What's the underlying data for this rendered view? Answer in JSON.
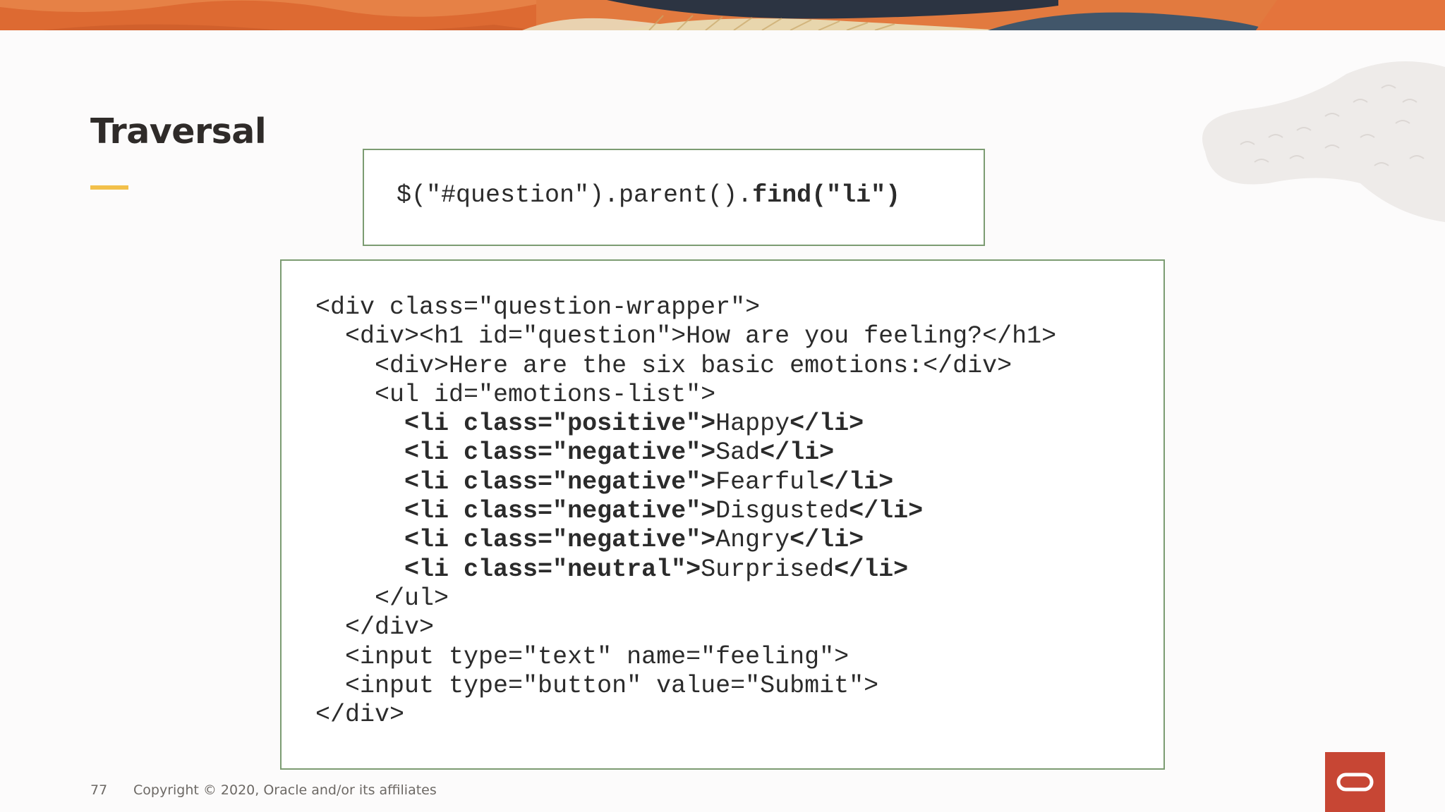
{
  "slide": {
    "title": "Traversal",
    "query": {
      "regular": "$(\"#question\").parent().",
      "bold": "find(\"li\")"
    },
    "code_lines": [
      {
        "indent": "",
        "parts": [
          {
            "t": "<div class=\"question-wrapper\">",
            "b": false
          }
        ]
      },
      {
        "indent": "  ",
        "parts": [
          {
            "t": "<div><h1 id=\"question\">How are you feeling?</h1>",
            "b": false
          }
        ]
      },
      {
        "indent": "    ",
        "parts": [
          {
            "t": "<div>Here are the six basic emotions:</div>",
            "b": false
          }
        ]
      },
      {
        "indent": "    ",
        "parts": [
          {
            "t": "<ul id=\"emotions-list\">",
            "b": false
          }
        ]
      },
      {
        "indent": "      ",
        "parts": [
          {
            "t": "<li class=\"positive\">",
            "b": true
          },
          {
            "t": "Happy",
            "b": false
          },
          {
            "t": "</li>",
            "b": true
          }
        ]
      },
      {
        "indent": "      ",
        "parts": [
          {
            "t": "<li class=\"negative\">",
            "b": true
          },
          {
            "t": "Sad",
            "b": false
          },
          {
            "t": "</li>",
            "b": true
          }
        ]
      },
      {
        "indent": "      ",
        "parts": [
          {
            "t": "<li class=\"negative\">",
            "b": true
          },
          {
            "t": "Fearful",
            "b": false
          },
          {
            "t": "</li>",
            "b": true
          }
        ]
      },
      {
        "indent": "      ",
        "parts": [
          {
            "t": "<li class=\"negative\">",
            "b": true
          },
          {
            "t": "Disgusted",
            "b": false
          },
          {
            "t": "</li>",
            "b": true
          }
        ]
      },
      {
        "indent": "      ",
        "parts": [
          {
            "t": "<li class=\"negative\">",
            "b": true
          },
          {
            "t": "Angry",
            "b": false
          },
          {
            "t": "</li>",
            "b": true
          }
        ]
      },
      {
        "indent": "      ",
        "parts": [
          {
            "t": "<li class=\"neutral\">",
            "b": true
          },
          {
            "t": "Surprised",
            "b": false
          },
          {
            "t": "</li>",
            "b": true
          }
        ]
      },
      {
        "indent": "    ",
        "parts": [
          {
            "t": "</ul>",
            "b": false
          }
        ]
      },
      {
        "indent": "  ",
        "parts": [
          {
            "t": "</div>",
            "b": false
          }
        ]
      },
      {
        "indent": "  ",
        "parts": [
          {
            "t": "<input type=\"text\" name=\"feeling\">",
            "b": false
          }
        ]
      },
      {
        "indent": "  ",
        "parts": [
          {
            "t": "<input type=\"button\" value=\"Submit\">",
            "b": false
          }
        ]
      },
      {
        "indent": "",
        "parts": [
          {
            "t": "</div>",
            "b": false
          }
        ]
      }
    ]
  },
  "footer": {
    "page_number": "77",
    "copyright": "Copyright © 2020, Oracle and/or its affiliates"
  },
  "logo": {
    "icon": "oracle-logo-icon"
  },
  "colors": {
    "accent_yellow": "#f2c04a",
    "box_border": "#7c9c72",
    "oracle_red": "#c74634",
    "banner_orange": "#e0703a"
  }
}
